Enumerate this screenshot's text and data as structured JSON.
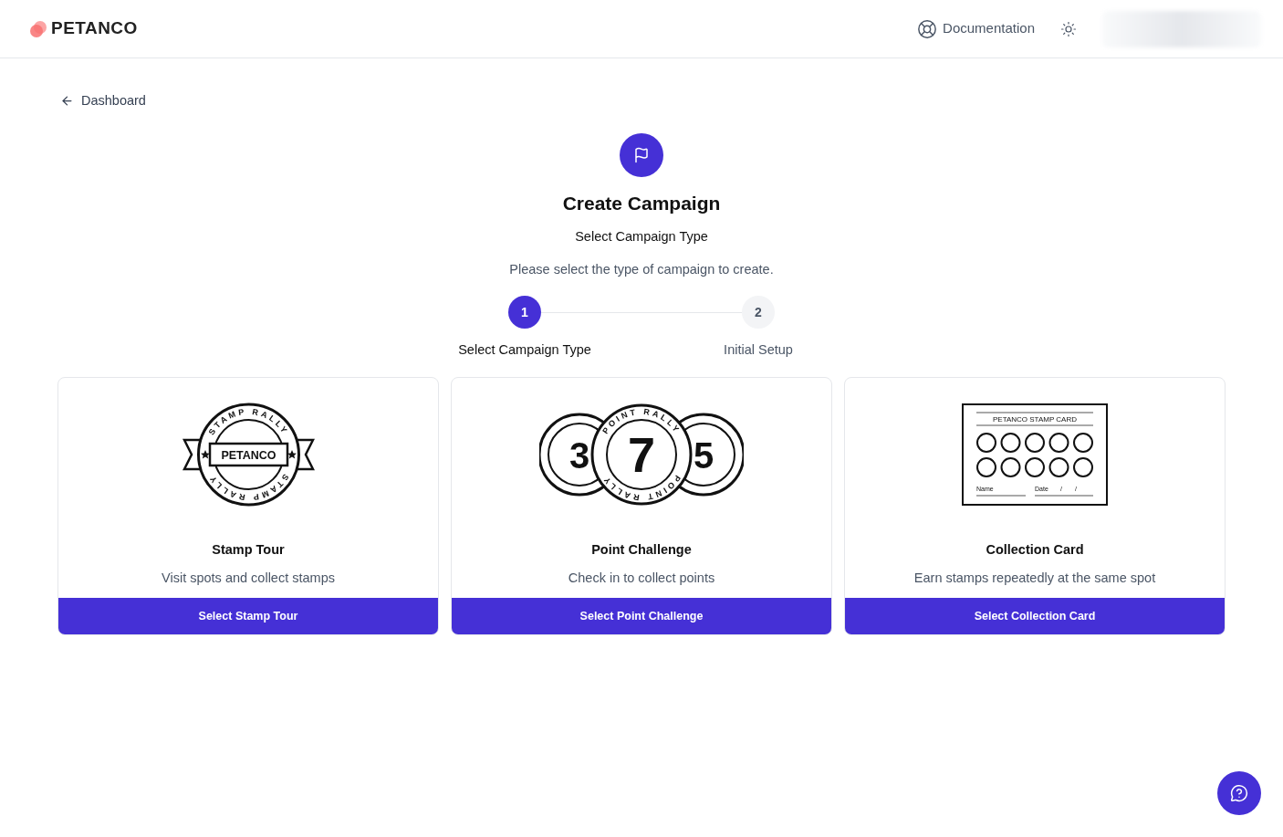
{
  "header": {
    "brand": "PETANCO",
    "documentation": "Documentation"
  },
  "back_link": "Dashboard",
  "title": "Create Campaign",
  "subtitle": "Select Campaign Type",
  "description": "Please select the type of campaign to create.",
  "steps": [
    {
      "number": "1",
      "label": "Select Campaign Type",
      "selected": true
    },
    {
      "number": "2",
      "label": "Initial Setup",
      "selected": false
    }
  ],
  "campaign_types": [
    {
      "kind": "stamp",
      "illustration": {
        "ring_top": "STAMP RALLY",
        "ring_bottom": "STAMP RALLY",
        "center": "PETANCO"
      },
      "title": "Stamp Tour",
      "description": "Visit spots and collect stamps",
      "button": "Select Stamp Tour"
    },
    {
      "kind": "point",
      "illustration": {
        "coins": [
          {
            "number": "3"
          },
          {
            "ring_top": "POINT RALLY",
            "ring_bottom": "POINT RALLY",
            "number": "7"
          },
          {
            "number": "5"
          }
        ]
      },
      "title": "Point Challenge",
      "description": "Check in to collect points",
      "button": "Select Point Challenge"
    },
    {
      "kind": "card",
      "illustration": {
        "heading": "PETANCO STAMP CARD",
        "name_label": "Name",
        "date_label": "Date",
        "date_marks": [
          "/",
          "/"
        ]
      },
      "title": "Collection Card",
      "description": "Earn stamps repeatedly at the same spot",
      "button": "Select Collection Card"
    }
  ]
}
